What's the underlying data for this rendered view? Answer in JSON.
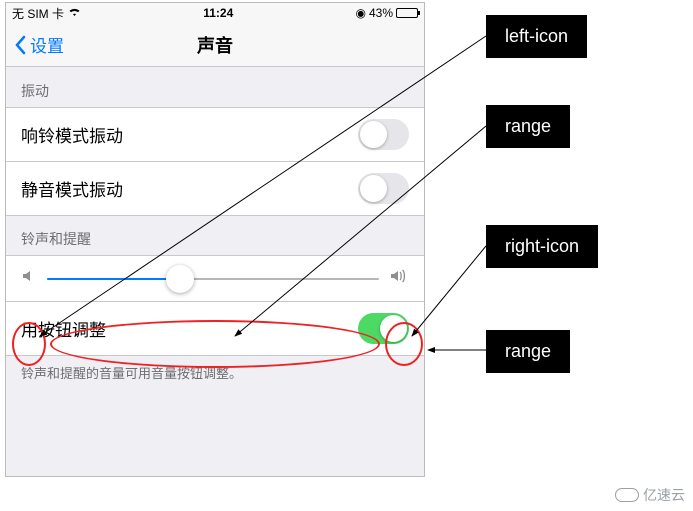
{
  "status": {
    "carrier": "无 SIM 卡",
    "time": "11:24",
    "battery_pct": "43%"
  },
  "nav": {
    "back_label": "设置",
    "title": "声音"
  },
  "sections": {
    "vibration_header": "振动",
    "ring_vibrate_label": "响铃模式振动",
    "silent_vibrate_label": "静音模式振动",
    "ringer_header": "铃声和提醒",
    "button_adjust_label": "用按钮调整",
    "footer": "铃声和提醒的音量可用音量按钮调整。"
  },
  "slider": {
    "value_pct": 40
  },
  "annotations": {
    "left_icon": "left-icon",
    "range1": "range",
    "right_icon": "right-icon",
    "range2": "range"
  },
  "watermark": "亿速云"
}
